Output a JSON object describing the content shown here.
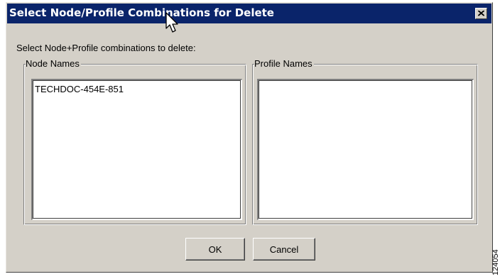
{
  "dialog": {
    "title": "Select Node/Profile Combinations for Delete",
    "prompt": "Select Node+Profile combinations to delete:",
    "node_group": {
      "label": "Node Names",
      "items": [
        "TECHDOC-454E-851"
      ]
    },
    "profile_group": {
      "label": "Profile Names",
      "items": []
    },
    "buttons": {
      "ok": "OK",
      "cancel": "Cancel"
    }
  },
  "figure_code": "124054",
  "icons": {
    "close": "close-icon",
    "cursor": "mouse-pointer-icon"
  },
  "colors": {
    "titlebar": "#0a246a",
    "dialog_face": "#d4d0c8"
  }
}
